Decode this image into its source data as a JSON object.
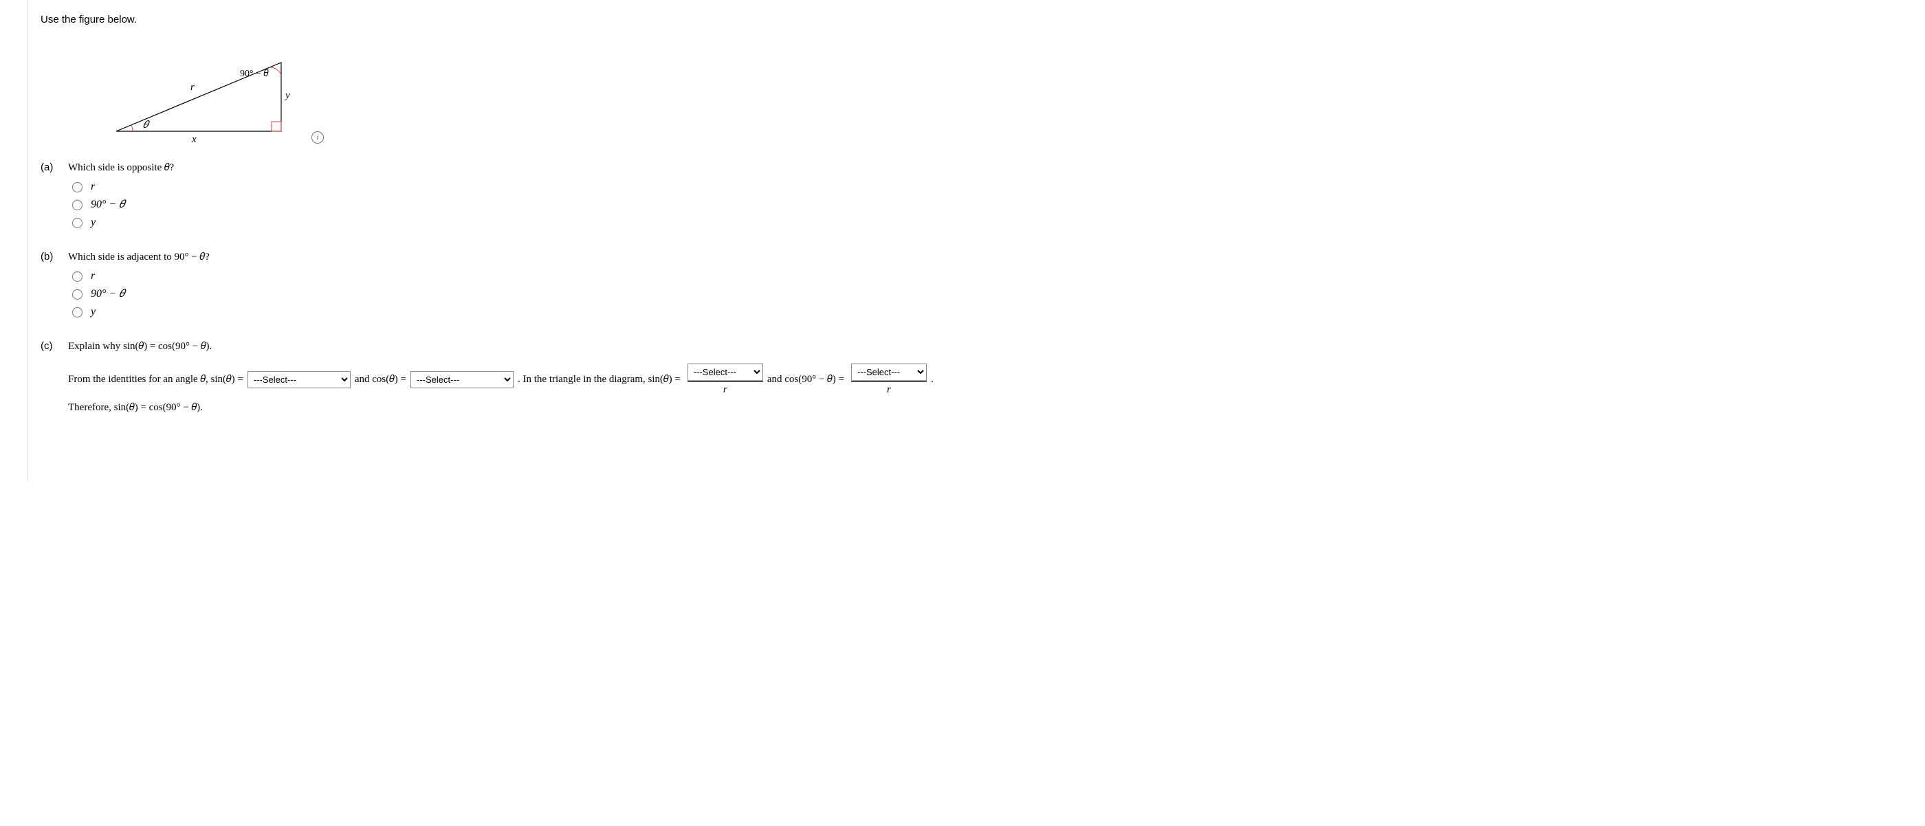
{
  "intro": "Use the figure below.",
  "figure": {
    "top_angle_label": "90° − 𝜃",
    "hyp_label": "r",
    "vert_label": "y",
    "base_label": "x",
    "left_angle_label": "𝜃"
  },
  "parts": {
    "a": {
      "label": "(a)",
      "question": "Which side is opposite 𝜃?",
      "options": [
        "r",
        "90° − 𝜃",
        "y"
      ]
    },
    "b": {
      "label": "(b)",
      "question": "Which side is adjacent to 90° − 𝜃?",
      "options": [
        "r",
        "90° − 𝜃",
        "y"
      ]
    },
    "c": {
      "label": "(c)",
      "question": "Explain why sin(𝜃) = cos(90° − 𝜃).",
      "s1": "From the identities for an angle 𝜃, sin(𝜃) = ",
      "sel_placeholder": "---Select---",
      "s2": " and cos(𝜃) = ",
      "s3": " . In the triangle in the diagram, sin(𝜃) = ",
      "frac_den": "r",
      "s4": " and cos(90° − 𝜃) = ",
      "s5": ".",
      "s6": "Therefore, sin(𝜃) = cos(90° − 𝜃)."
    }
  }
}
